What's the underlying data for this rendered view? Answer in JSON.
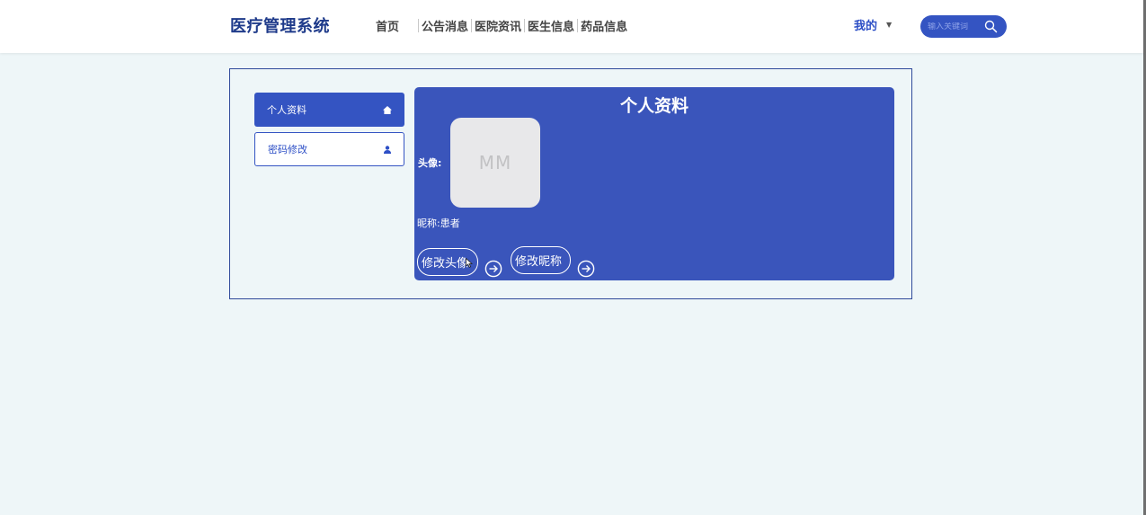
{
  "header": {
    "brand": "医疗管理系统",
    "nav": [
      "首页",
      "公告消息",
      "医院资讯",
      "医生信息",
      "药品信息"
    ],
    "me": "我的",
    "search_placeholder": "输入关键词"
  },
  "sidebar": {
    "items": [
      {
        "label": "个人资料",
        "icon": "home-icon"
      },
      {
        "label": "密码修改",
        "icon": "user-icon"
      }
    ]
  },
  "profile": {
    "title": "个人资料",
    "avatar_label": "头像:",
    "avatar_text": "MM",
    "nickname_label": "昵称:",
    "nickname_value": "患者",
    "change_avatar_button": "修改头像",
    "change_nickname_button": "修改昵称"
  },
  "colors": {
    "brand": "#1e3a8a",
    "accent": "#3454c2",
    "panel": "#3a55bb",
    "page_bg": "#eef6f8"
  }
}
